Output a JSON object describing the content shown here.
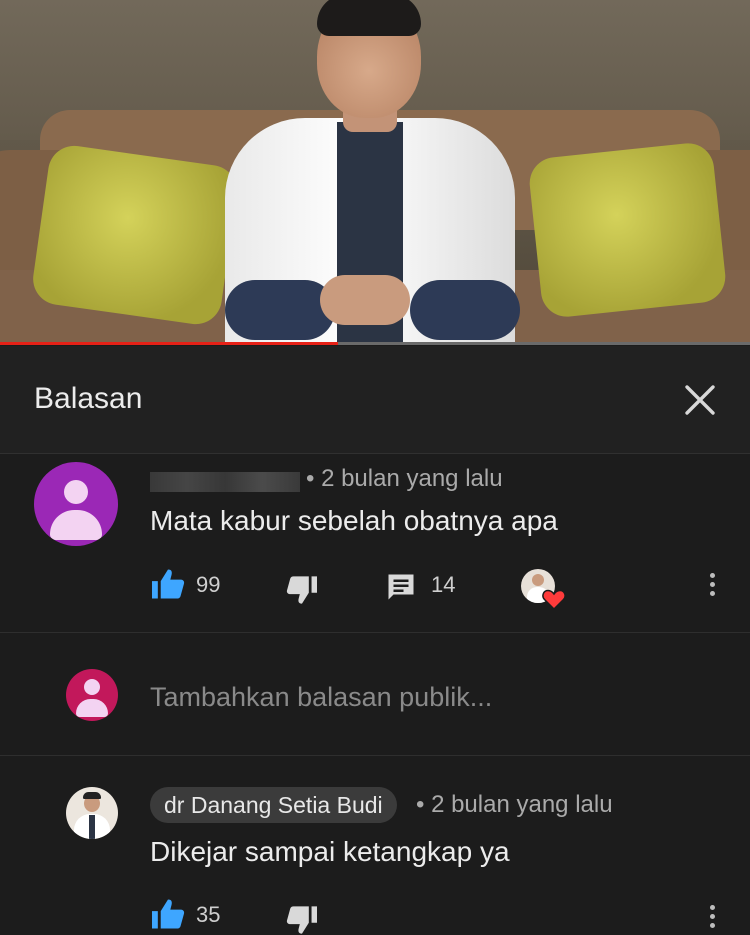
{
  "video": {
    "progress_fraction": 0.45
  },
  "panel": {
    "title": "Balasan",
    "close_icon": "close-icon"
  },
  "comment": {
    "time": "• 2 bulan yang lalu",
    "text": "Mata kabur sebelah obatnya apa",
    "likes": "99",
    "replies": "14",
    "avatar_color": "#9b28b6"
  },
  "reply_input": {
    "placeholder": "Tambahkan balasan publik...",
    "avatar_color": "#c2185b"
  },
  "reply": {
    "author": "dr Danang Setia Budi",
    "time": "• 2 bulan yang lalu",
    "text": "Dikejar sampai ketangkap ya",
    "likes": "35"
  },
  "colors": {
    "like_blue": "#3ea6ff",
    "progress_red": "#e62117",
    "heart_red": "#ff3b3b"
  }
}
